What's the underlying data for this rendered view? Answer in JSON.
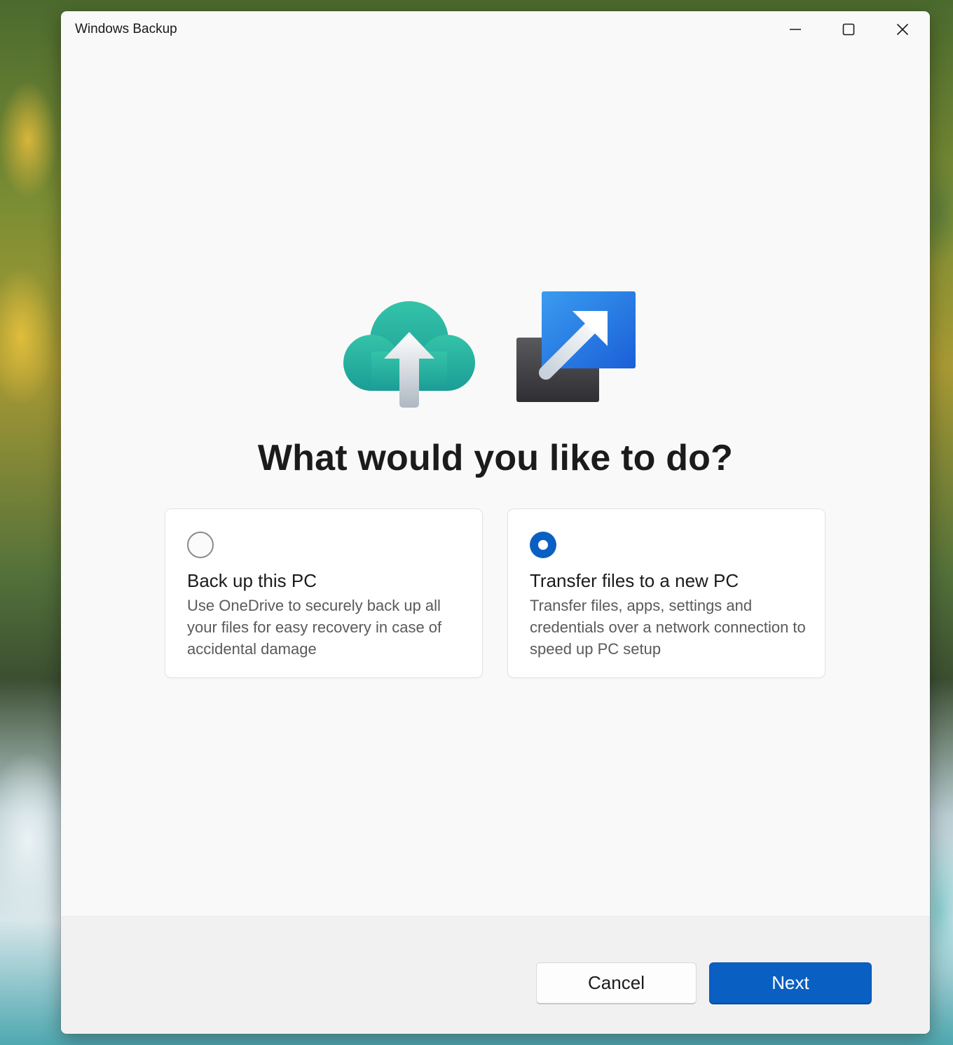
{
  "window": {
    "title": "Windows Backup",
    "controls": {
      "minimize_icon": "minimize-icon",
      "maximize_icon": "maximize-icon",
      "close_icon": "close-icon"
    }
  },
  "hero": {
    "icons": [
      "cloud-upload-icon",
      "transfer-arrow-icon"
    ],
    "heading": "What would you like to do?"
  },
  "options": [
    {
      "title": "Back up this PC",
      "description": "Use OneDrive to securely back up all your files for easy recovery in case of accidental damage",
      "selected": false
    },
    {
      "title": "Transfer files to a new PC",
      "description": "Transfer files, apps, settings and credentials over a network connection to speed up PC setup",
      "selected": true
    }
  ],
  "footer": {
    "cancel_label": "Cancel",
    "next_label": "Next"
  },
  "colors": {
    "accent": "#0a5fc2",
    "cloud_teal": "#2bb5a0",
    "transfer_blue": "#2a7de8",
    "window_bg": "#f9f9f9",
    "footer_bg": "#f1f1f1"
  }
}
